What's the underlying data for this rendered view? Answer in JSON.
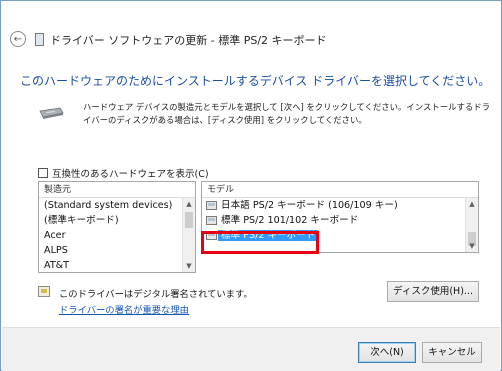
{
  "window": {
    "title": "ドライバー ソフトウェアの更新 - 標準 PS/2 キーボード"
  },
  "main": {
    "heading": "このハードウェアのためにインストールするデバイス ドライバーを選択してください。",
    "description": "ハードウェア デバイスの製造元とモデルを選択して [次へ] をクリックしてください。インストールするドライバーのディスクがある場合は、[ディスク使用] をクリックしてください。",
    "compatible_checkbox_label": "互換性のあるハードウェアを表示(C)",
    "compatible_checked": false
  },
  "manufacturer_list": {
    "header": "製造元",
    "items": [
      {
        "label": "(Standard system devices)"
      },
      {
        "label": "(標準キーボード)"
      },
      {
        "label": "Acer"
      },
      {
        "label": "ALPS"
      },
      {
        "label": "AT&T"
      }
    ]
  },
  "model_list": {
    "header": "モデル",
    "items": [
      {
        "label": "日本語 PS/2 キーボード (106/109 キー)",
        "selected": false
      },
      {
        "label": "標準 PS/2 101/102 キーボード",
        "selected": false
      },
      {
        "label": "標準 PS/2 キーボード",
        "selected": true
      }
    ]
  },
  "signature": {
    "text": "このドライバーはデジタル署名されています。",
    "link": "ドライバーの署名が重要な理由"
  },
  "buttons": {
    "have_disk": "ディスク使用(H)...",
    "next": "次へ(N)",
    "cancel": "キャンセル"
  },
  "colors": {
    "heading": "#1a4fa3",
    "selection": "#3399ff",
    "highlight_box": "#e60012",
    "link": "#1a57b5"
  }
}
